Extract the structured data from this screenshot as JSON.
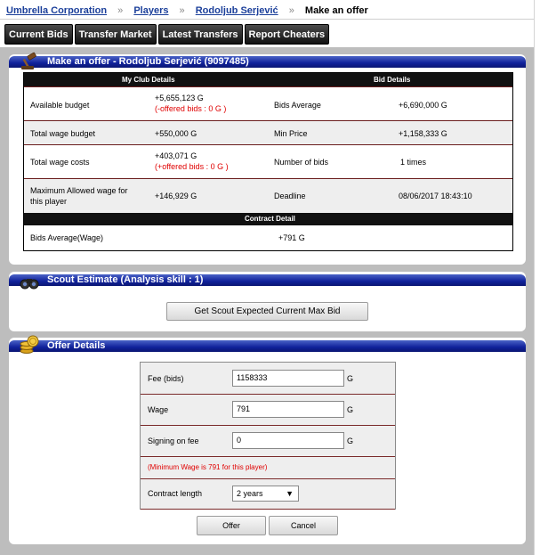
{
  "breadcrumb": {
    "crumb1": "Umbrella Corporation",
    "crumb2": "Players",
    "crumb3": "Rodoljub Serjević",
    "current": "Make an offer",
    "separator": "»"
  },
  "tabs": [
    "Current Bids",
    "Transfer Market",
    "Latest Transfers",
    "Report Cheaters"
  ],
  "make_offer": {
    "title": "Make an offer - Rodoljub Serjević (9097485)",
    "icon": "auction-gavel-icon",
    "club_header": "My Club Details",
    "bid_header": "Bid Details",
    "contract_header": "Contract Detail",
    "rows": [
      {
        "label": "Available budget",
        "value": "+5,655,123 G",
        "note": "(-offered bids : 0 G )",
        "label2": "Bids Average",
        "value2": "+6,690,000 G"
      },
      {
        "label": "Total wage budget",
        "value": "+550,000 G",
        "note": "",
        "label2": "Min Price",
        "value2": "+1,158,333 G"
      },
      {
        "label": "Total wage costs",
        "value": "+403,071 G",
        "note": "(+offered bids : 0 G )",
        "label2": "Number of bids",
        "value2": "1 times"
      },
      {
        "label": "Maximum Allowed wage for this player",
        "value": "+146,929 G",
        "note": "",
        "label2": "Deadline",
        "value2": "08/06/2017 18:43:10"
      }
    ],
    "contract_row": {
      "label": "Bids Average(Wage)",
      "value": "+791 G"
    }
  },
  "scout": {
    "title": "Scout Estimate (Analysis skill : 1)",
    "icon": "binoculars-icon",
    "button": "Get Scout Expected Current Max Bid"
  },
  "offer": {
    "title": "Offer Details",
    "icon": "coins-icon",
    "fee_label": "Fee (bids)",
    "fee_value": "1158333",
    "wage_label": "Wage",
    "wage_value": "791",
    "signing_label": "Signing on fee",
    "signing_value": "0",
    "unit": "G",
    "min_wage_note": "(Minimum Wage is 791 for this player)",
    "contract_label": "Contract length",
    "contract_value": "2 years",
    "offer_button": "Offer",
    "cancel_button": "Cancel"
  },
  "colors": {
    "header_blue": "#10219a",
    "link": "#1b3f9a",
    "warning_red": "#e00000",
    "frame_gray": "#bdbdbd"
  }
}
